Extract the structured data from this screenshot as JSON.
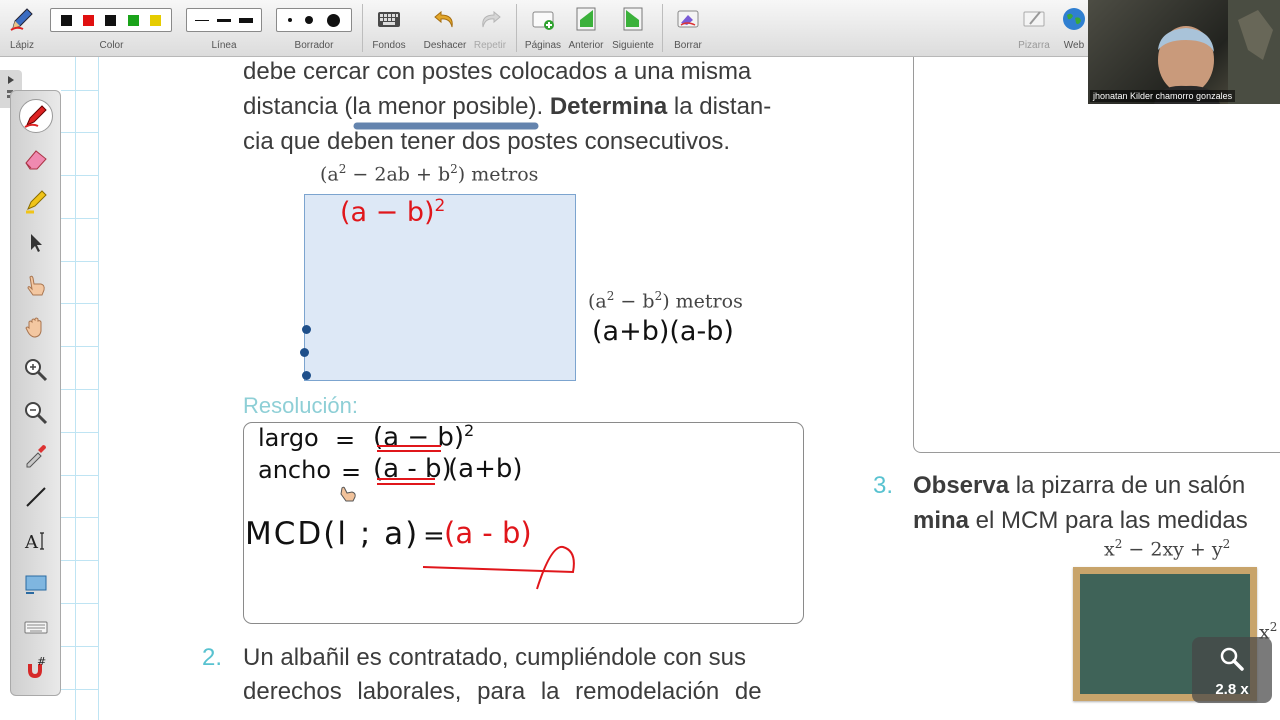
{
  "toolbar": {
    "lapiz": "Lápiz",
    "color": "Color",
    "linea": "Línea",
    "borrador": "Borrador",
    "fondos": "Fondos",
    "deshacer": "Deshacer",
    "repetir": "Repetir",
    "paginas": "Páginas",
    "anterior": "Anterior",
    "siguiente": "Siguiente",
    "borrar": "Borrar",
    "pizarra": "Pizarra",
    "web": "Web",
    "colors": [
      "#111111",
      "#e01010",
      "#111111",
      "#1aa31a",
      "#e6cc00"
    ]
  },
  "webcam": {
    "name": "jhonatan Kilder chamorro gonzales"
  },
  "zoom": {
    "level": "2.8 x"
  },
  "problem1": {
    "line1": "debe cercar con postes colocados a una misma",
    "line2_a": "distancia (",
    "line2_b": "la menor posible",
    "line2_c": "). ",
    "line2_bold": "Determina",
    "line2_d": " la distan-",
    "line3": "cia que deben tener dos postes consecutivos.",
    "top_label_a": "(a",
    "top_label_b": " − 2ab + b",
    "top_label_c": ") metros",
    "side_label_a": "(a",
    "side_label_b": " − b",
    "side_label_c": ") metros",
    "exp2": "2",
    "resolucion": "Resolución:"
  },
  "handwriting": {
    "top_factor": "(a − b)",
    "top_exp": "2",
    "side_factor": "(a+b)(a-b)",
    "largo_label": "largo",
    "eq": "=",
    "largo_value": "(a − b)",
    "largo_exp": "2",
    "ancho_label": "ancho",
    "ancho_value": "(a - b)",
    "ancho_value2": "(a+b)",
    "mcd_label": "MCD(l ; a)",
    "mcd_result": "(a - b)"
  },
  "problem2": {
    "number": "2.",
    "line1": "Un albañil es contratado, cumpliéndole con sus",
    "line2": "derechos laborales, para la remodelación de"
  },
  "problem3": {
    "number": "3.",
    "bold1": "Observa",
    "line1": " la pizarra de un salón",
    "bold2": "mina",
    "line2": " el MCM para las medidas",
    "board_label_a": "x",
    "board_label_b": " − 2xy + y",
    "board_exp": "2",
    "board_side": "x"
  }
}
